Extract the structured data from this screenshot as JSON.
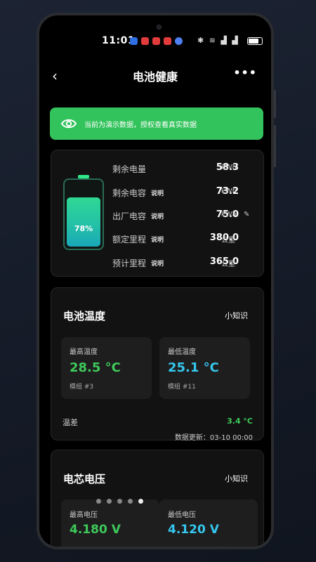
{
  "status_bar": {
    "time": "11:01",
    "icons": [
      "bluetooth-icon",
      "wifi-icon",
      "signal-icon",
      "signal-icon",
      "battery-icon"
    ],
    "bluetooth": "✱",
    "wifi": "≋",
    "signal1": "▟",
    "signal2": "▟"
  },
  "header": {
    "back_label": "‹",
    "title": "电池健康",
    "more_label": "•••"
  },
  "banner": {
    "text": "当前为演示数据，授权查看真实数据",
    "color": "#33c35c"
  },
  "battery_card": {
    "percent": 78,
    "percent_label": "78%",
    "rows": [
      {
        "label": "剩余电量",
        "tip": "",
        "value": "58.3",
        "unit": "kWh"
      },
      {
        "label": "剩余电容",
        "tip": "说明",
        "value": "73.2",
        "unit": "kWh"
      },
      {
        "label": "出厂电容",
        "tip": "说明",
        "value": "75.0",
        "unit": "kWh",
        "edit": "✎"
      },
      {
        "label": "额定里程",
        "tip": "说明",
        "value": "380.0",
        "unit": "公里"
      },
      {
        "label": "预计里程",
        "tip": "说明",
        "value": "365.0",
        "unit": "公里"
      }
    ]
  },
  "temperature": {
    "title": "电池温度",
    "tips_link": "小知识",
    "max": {
      "label": "最高温度",
      "value": "28.5 °C",
      "module": "模组 #3",
      "color": "#3ec95a"
    },
    "min": {
      "label": "最低温度",
      "value": "25.1 °C",
      "module": "模组 #11",
      "color": "#35c7ee"
    },
    "diff_label": "温差",
    "diff_value": "3.4 °C",
    "updated": "数据更新：03-10 00:00"
  },
  "voltage": {
    "title": "电芯电压",
    "tips_link": "小知识",
    "max": {
      "label": "最高电压",
      "value": "4.180 V",
      "color": "#3ec95a"
    },
    "min": {
      "label": "最低电压",
      "value": "4.120 V",
      "color": "#35c7ee"
    }
  },
  "pager": {
    "count": 5,
    "active": 4
  }
}
